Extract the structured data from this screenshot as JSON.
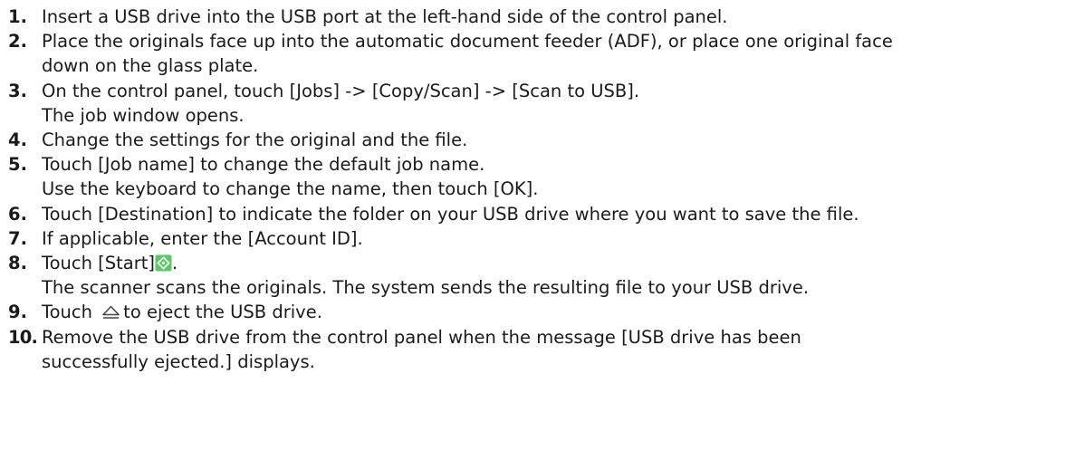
{
  "steps": [
    {
      "num": "1.",
      "lines": [
        "Insert a USB drive into the USB port at the left-hand side of the control panel."
      ]
    },
    {
      "num": "2.",
      "lines": [
        "Place the originals face up into the automatic document feeder (ADF), or place one original face",
        "down on the glass plate."
      ]
    },
    {
      "num": "3.",
      "lines": [
        "On the control panel, touch [Jobs] -> [Copy/Scan] -> [Scan to USB].",
        "The job window opens."
      ]
    },
    {
      "num": "4.",
      "lines": [
        "Change the settings for the original and the file."
      ]
    },
    {
      "num": "5.",
      "lines": [
        "Touch [Job name] to change the default job name.",
        "Use the keyboard to change the name, then touch [OK]."
      ]
    },
    {
      "num": "6.",
      "lines": [
        "Touch [Destination] to indicate the folder on your USB drive where you want to save the file."
      ]
    },
    {
      "num": "7.",
      "lines": [
        "If applicable, enter the [Account ID]."
      ]
    },
    {
      "num": "8.",
      "before_icon": "Touch [Start]",
      "after_icon": ".",
      "icon": "start-icon",
      "lines": [
        "The scanner scans the originals. The system sends the resulting file to your USB drive."
      ]
    },
    {
      "num": "9.",
      "before_icon": "Touch ",
      "after_icon": "to eject the USB drive.",
      "icon": "eject-icon"
    },
    {
      "num": "10.",
      "lines": [
        "Remove the USB drive from the control panel when the message [USB drive has been",
        "successfully ejected.] displays."
      ]
    }
  ],
  "colors": {
    "text": "#1a1a1a",
    "start_icon_fill": "#5cc86a",
    "start_icon_symbol": "#ffffff",
    "eject_icon_stroke": "#444444"
  }
}
